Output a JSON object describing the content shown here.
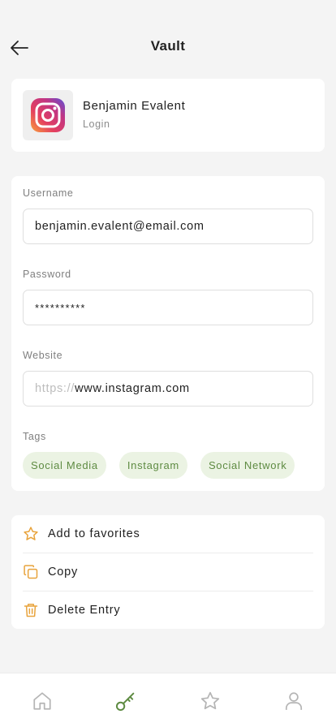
{
  "header": {
    "title": "Vault"
  },
  "entry": {
    "name": "Benjamin Evalent",
    "type": "Login",
    "app_icon": "instagram-logo"
  },
  "fields": {
    "username": {
      "label": "Username",
      "value": "benjamin.evalent@email.com"
    },
    "password": {
      "label": "Password",
      "value": "**********"
    },
    "website": {
      "label": "Website",
      "prefix": "https://",
      "value": "www.instagram.com"
    }
  },
  "tags": {
    "label": "Tags",
    "items": [
      "Social Media",
      "Instagram",
      "Social Network"
    ]
  },
  "actions": [
    {
      "label": "Add to favorites",
      "icon": "star-icon"
    },
    {
      "label": "Copy",
      "icon": "copy-icon"
    },
    {
      "label": "Delete Entry",
      "icon": "trash-icon"
    }
  ],
  "bottom_nav": [
    {
      "icon": "home-icon",
      "active": false
    },
    {
      "icon": "key-icon",
      "active": true
    },
    {
      "icon": "star-icon",
      "active": false
    },
    {
      "icon": "user-icon",
      "active": false
    }
  ],
  "colors": {
    "background": "#f4f4f4",
    "card": "#ffffff",
    "accent_green": "#5e8b42",
    "tag_bg": "#ebf3e3",
    "action_icon_orange": "#e8a33c",
    "nav_inactive": "#b5b5b5"
  }
}
